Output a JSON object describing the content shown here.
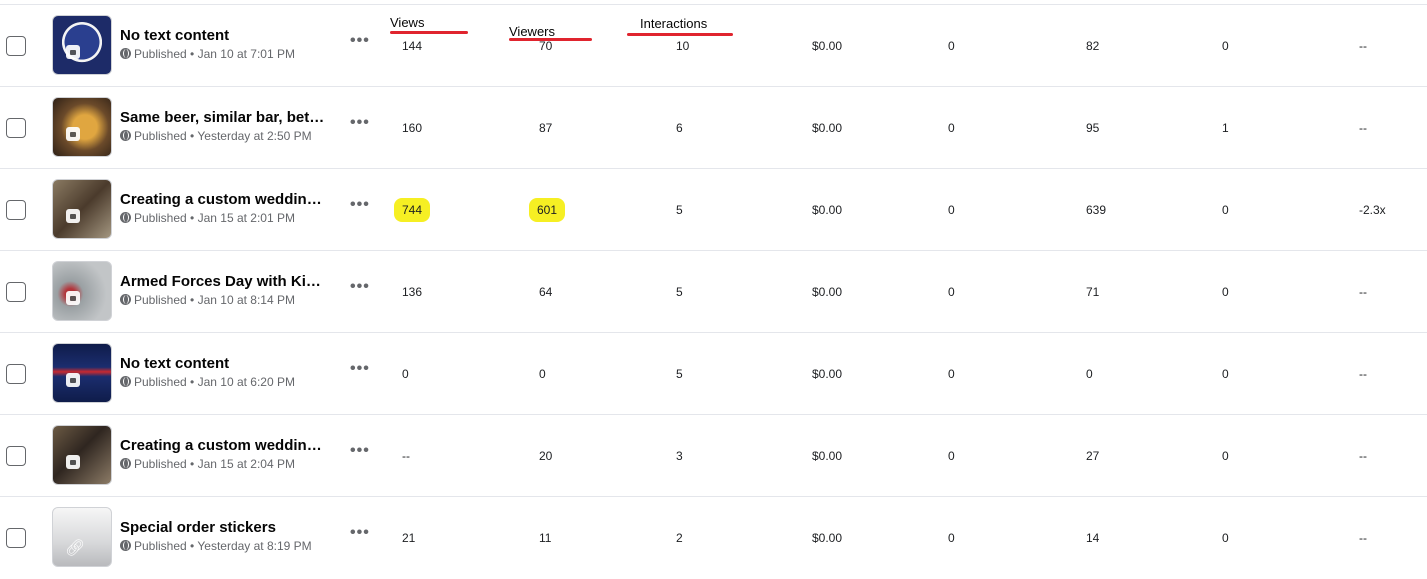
{
  "annotations": {
    "views": "Views",
    "viewers": "Viewers",
    "interactions": "Interactions",
    "underline_color": "#e0242e",
    "highlight_color": "#f6ef23"
  },
  "rows": [
    {
      "title": "No text content",
      "status": "Published",
      "date": "Jan 10 at 7:01 PM",
      "views": "144",
      "viewers": "70",
      "interactions": "10",
      "spend": "$0.00",
      "col5": "0",
      "col6": "82",
      "col7": "0",
      "col8": "--",
      "thumb": "king-printing-logo"
    },
    {
      "title": "Same beer, similar bar, bette...",
      "status": "Published",
      "date": "Yesterday at 2:50 PM",
      "views": "160",
      "viewers": "87",
      "interactions": "6",
      "spend": "$0.00",
      "col5": "0",
      "col6": "95",
      "col7": "1",
      "col8": "--",
      "thumb": "beer-mug-photo"
    },
    {
      "title": "Creating a custom wedding ...",
      "status": "Published",
      "date": "Jan 15 at 2:01 PM",
      "views": "744",
      "viewers": "601",
      "interactions": "5",
      "spend": "$0.00",
      "col5": "0",
      "col6": "639",
      "col7": "0",
      "col8": "-2.3x",
      "thumb": "wedding-video"
    },
    {
      "title": "Armed Forces Day with King...",
      "status": "Published",
      "date": "Jan 10 at 8:14 PM",
      "views": "136",
      "viewers": "64",
      "interactions": "5",
      "spend": "$0.00",
      "col5": "0",
      "col6": "71",
      "col7": "0",
      "col8": "--",
      "thumb": "floor-photo"
    },
    {
      "title": "No text content",
      "status": "Published",
      "date": "Jan 10 at 6:20 PM",
      "views": "0",
      "viewers": "0",
      "interactions": "5",
      "spend": "$0.00",
      "col5": "0",
      "col6": "0",
      "col7": "0",
      "col8": "--",
      "thumb": "king-printing-flyer"
    },
    {
      "title": "Creating a custom wedding ...",
      "status": "Published",
      "date": "Jan 15 at 2:04 PM",
      "views": "--",
      "viewers": "20",
      "interactions": "3",
      "spend": "$0.00",
      "col5": "0",
      "col6": "27",
      "col7": "0",
      "col8": "--",
      "thumb": "wedding-photo"
    },
    {
      "title": "Special order stickers",
      "status": "Published",
      "date": "Yesterday at 8:19 PM",
      "views": "21",
      "viewers": "11",
      "interactions": "2",
      "spend": "$0.00",
      "col5": "0",
      "col6": "14",
      "col7": "0",
      "col8": "--",
      "thumb": "link-placeholder"
    }
  ]
}
